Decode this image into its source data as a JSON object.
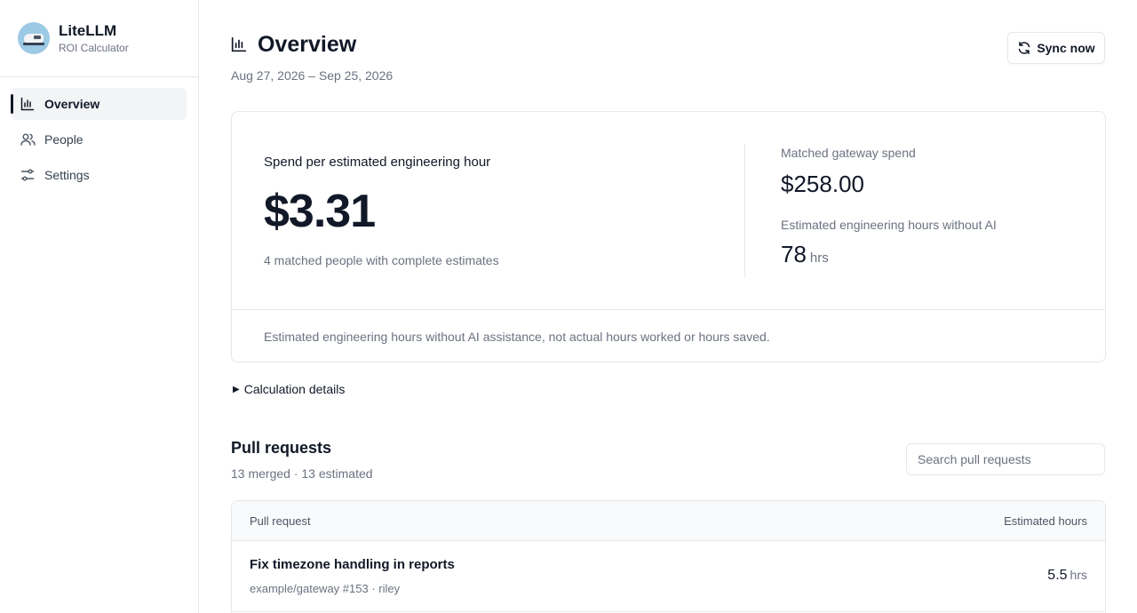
{
  "brand": {
    "name": "LiteLLM",
    "subtitle": "ROI Calculator",
    "logo_icon": "train-logo-icon"
  },
  "sidebar": {
    "items": [
      {
        "label": "Overview",
        "icon": "bar-chart-icon",
        "active": true
      },
      {
        "label": "People",
        "icon": "users-icon",
        "active": false
      },
      {
        "label": "Settings",
        "icon": "sliders-icon",
        "active": false
      }
    ]
  },
  "header": {
    "title": "Overview",
    "icon": "bar-chart-icon",
    "date_range": "Aug 27, 2026 – Sep 25, 2026",
    "sync_label": "Sync now",
    "sync_icon": "refresh-icon"
  },
  "summary": {
    "metric_label": "Spend per estimated engineering hour",
    "metric_value": "$3.31",
    "metric_sub": "4 matched people with complete estimates",
    "spend_label": "Matched gateway spend",
    "spend_value": "$258.00",
    "hours_label": "Estimated engineering hours without AI",
    "hours_value": "78",
    "hours_unit": "hrs",
    "footer_note": "Estimated engineering hours without AI assistance, not actual hours worked or hours saved."
  },
  "details": {
    "label": "Calculation details"
  },
  "pull_requests": {
    "title": "Pull requests",
    "subtitle": "13 merged · 13 estimated",
    "search_placeholder": "Search pull requests",
    "columns": {
      "name": "Pull request",
      "hours": "Estimated hours"
    },
    "rows": [
      {
        "title": "Fix timezone handling in reports",
        "meta": "example/gateway #153 · riley",
        "hours": "5.5",
        "unit": "hrs"
      }
    ]
  },
  "colors": {
    "accent": "#111827",
    "muted": "#6b7280",
    "border": "#e5e7eb",
    "avatar_bg": "#9cc9e4"
  }
}
